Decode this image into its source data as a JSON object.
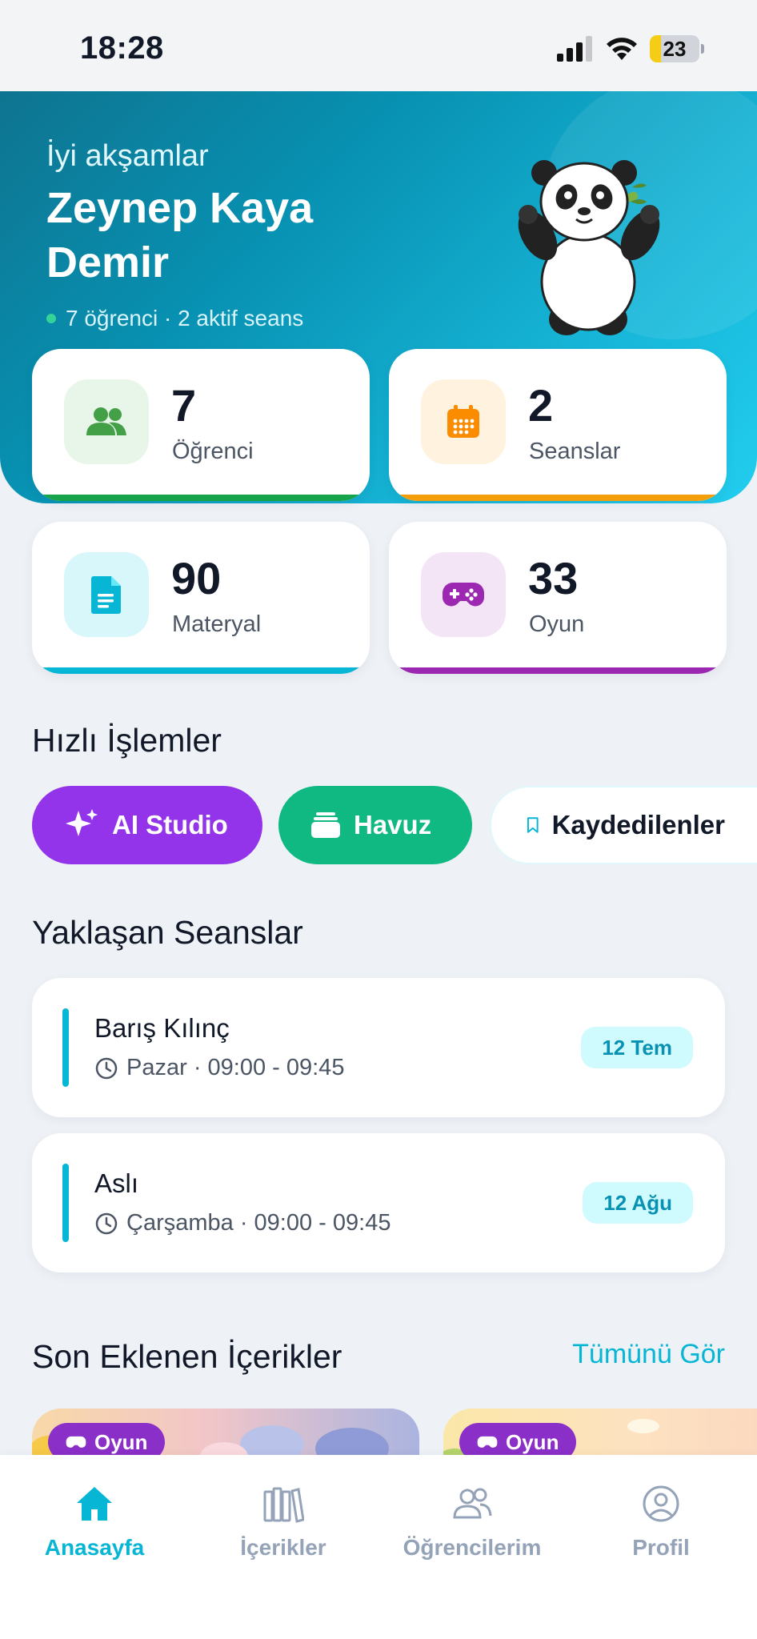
{
  "status_bar": {
    "time": "18:28",
    "battery": "23",
    "battery_level_percent": 23
  },
  "hero": {
    "greeting": "İyi akşamlar",
    "user_name": "Zeynep Kaya Demir",
    "summary": "7 öğrenci · 2 aktif seans"
  },
  "stats": [
    {
      "value": "7",
      "label": "Öğrenci",
      "icon": "users-icon",
      "accent": "#16a34a",
      "icon_bg": "#e8f5e9"
    },
    {
      "value": "2",
      "label": "Seanslar",
      "icon": "calendar-icon",
      "accent": "#f59e0b",
      "icon_bg": "#fff3e0"
    },
    {
      "value": "90",
      "label": "Materyal",
      "icon": "document-icon",
      "accent": "#06b6d4",
      "icon_bg": "#d7f7fb"
    },
    {
      "value": "33",
      "label": "Oyun",
      "icon": "gamepad-icon",
      "accent": "#9c27b0",
      "icon_bg": "#f3e5f5"
    }
  ],
  "quick_actions": {
    "title": "Hızlı İşlemler",
    "items": [
      {
        "label": "AI Studio",
        "icon": "sparkles-icon",
        "color": "#9333ea"
      },
      {
        "label": "Havuz",
        "icon": "stack-icon",
        "color": "#10b981"
      },
      {
        "label": "Kaydedilenler",
        "icon": "bookmark-icon",
        "color": "#ffffff"
      }
    ]
  },
  "upcoming_sessions": {
    "title": "Yaklaşan Seanslar",
    "items": [
      {
        "name": "Barış Kılınç",
        "time": "Pazar · 09:00 - 09:45",
        "date": "12 Tem"
      },
      {
        "name": "Aslı",
        "time": "Çarşamba · 09:00 - 09:45",
        "date": "12 Ağu"
      }
    ]
  },
  "recent_content": {
    "title": "Son Eklenen İçerikler",
    "see_all": "Tümünü Gör",
    "items": [
      {
        "badge": "Oyun",
        "icon": "gamepad-icon"
      },
      {
        "badge": "Oyun",
        "icon": "gamepad-icon"
      }
    ]
  },
  "tab_bar": {
    "items": [
      {
        "label": "Anasayfa",
        "icon": "home-icon",
        "active": true
      },
      {
        "label": "İçerikler",
        "icon": "library-icon",
        "active": false
      },
      {
        "label": "Öğrencilerim",
        "icon": "students-icon",
        "active": false
      },
      {
        "label": "Profil",
        "icon": "profile-icon",
        "active": false
      }
    ]
  },
  "colors": {
    "accent": "#06b6d4",
    "hero_start": "#0e7490",
    "hero_end": "#22cdee",
    "background": "#eef2f7"
  }
}
